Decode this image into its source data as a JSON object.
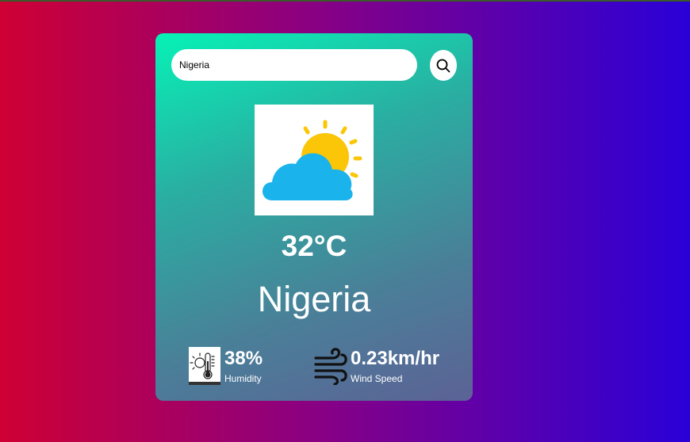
{
  "search": {
    "value": "Nigeria",
    "placeholder": ""
  },
  "icons": {
    "search": "search-icon",
    "weather": "partly-cloudy-icon",
    "humidity": "thermometer-sun-icon",
    "wind": "wind-icon"
  },
  "weather": {
    "temperature": "32°C",
    "city": "Nigeria",
    "humidity": {
      "value": "38%",
      "label": "Humidity"
    },
    "wind": {
      "value": "0.23km/hr",
      "label": "Wind Speed"
    }
  },
  "colors": {
    "bg_left": "#cf0034",
    "bg_right": "#2a00d8",
    "card_top": "#06f2b6",
    "sun": "#fbc508",
    "cloud": "#1ab3ec"
  }
}
